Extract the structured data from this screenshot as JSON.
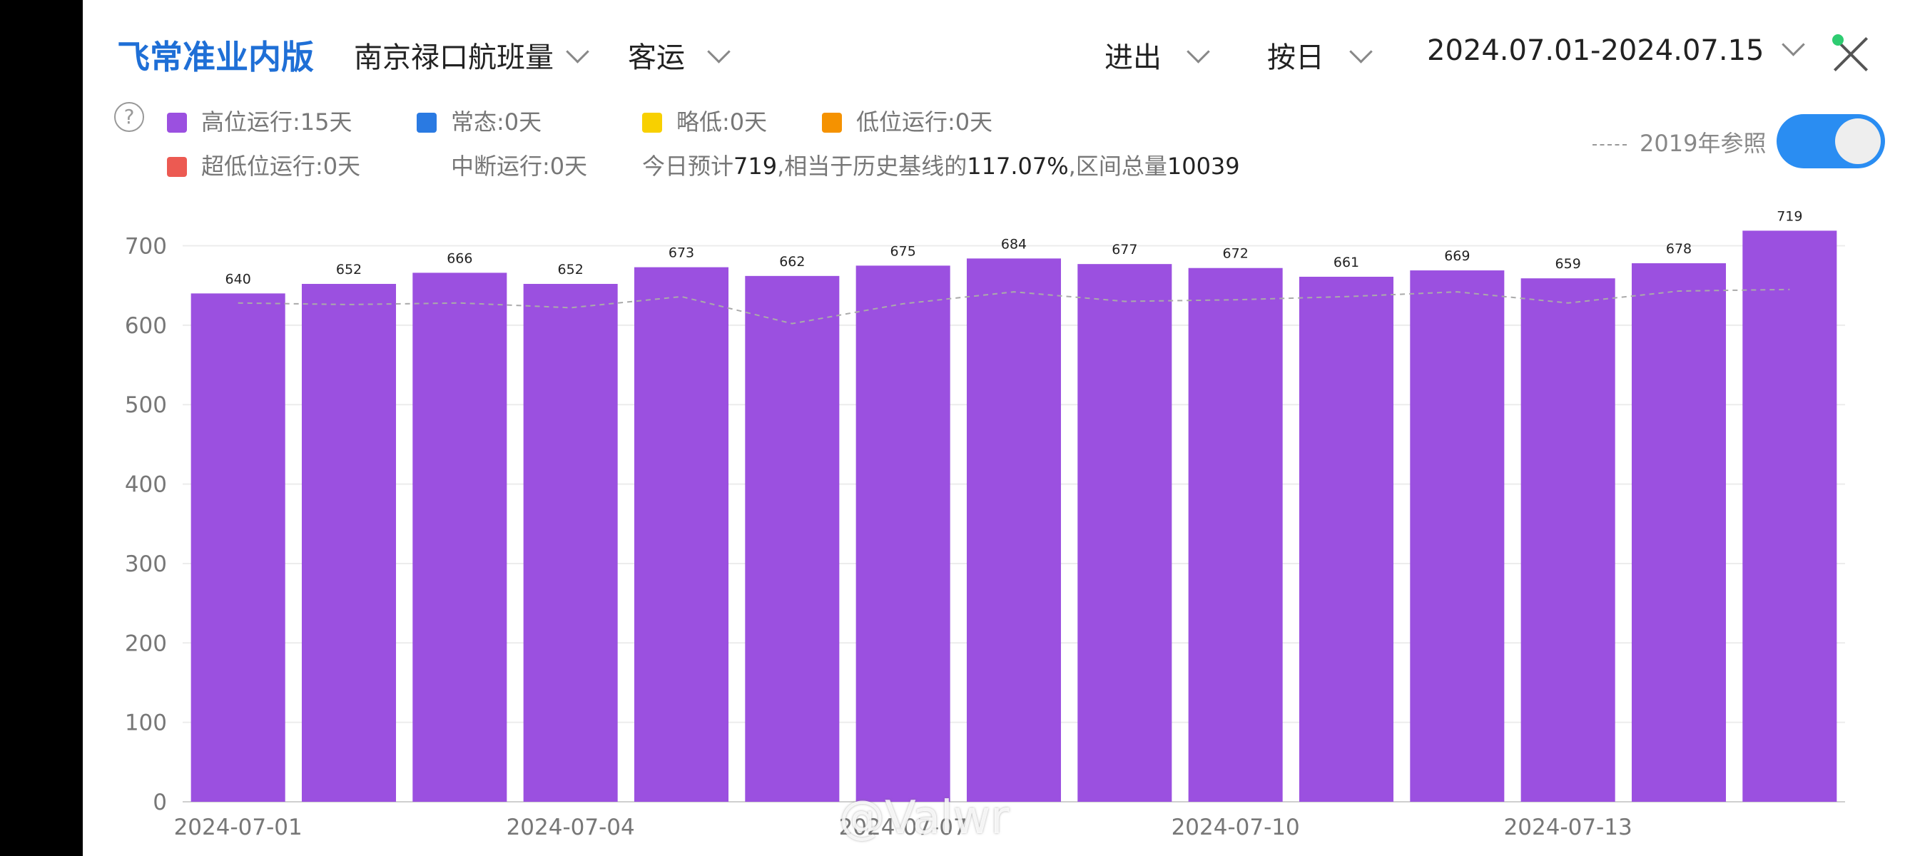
{
  "header": {
    "title": "飞常准业内版",
    "airport_label": "南京禄口航班量",
    "type_label": "客运",
    "direction_label": "进出",
    "granularity_label": "按日",
    "date_range_label": "2024.07.01-2024.07.15"
  },
  "legend": {
    "items": [
      {
        "label": "高位运行:15天",
        "color": "#9b50e0"
      },
      {
        "label": "常态:0天",
        "color": "#2a7ae2"
      },
      {
        "label": "略低:0天",
        "color": "#f8d000"
      },
      {
        "label": "低位运行:0天",
        "color": "#f59200"
      },
      {
        "label": "超低位运行:0天",
        "color": "#ec5a52"
      },
      {
        "label": "中断运行:0天",
        "color": ""
      }
    ],
    "summary": {
      "prefix": "今日预计",
      "today": "719",
      "mid": ",相当于历史基线的",
      "percent": "117.07%",
      "mid2": ",区间总量",
      "total": "10039"
    },
    "reference_label": "2019年参照",
    "reference_toggle_on": true
  },
  "watermark": "@Valwr",
  "chart_data": {
    "type": "bar",
    "categories": [
      "2024-07-01",
      "2024-07-02",
      "2024-07-03",
      "2024-07-04",
      "2024-07-05",
      "2024-07-06",
      "2024-07-07",
      "2024-07-08",
      "2024-07-09",
      "2024-07-10",
      "2024-07-11",
      "2024-07-12",
      "2024-07-13",
      "2024-07-14",
      "2024-07-15"
    ],
    "x_tick_labels_shown": [
      "2024-07-01",
      "2024-07-04",
      "2024-07-07",
      "2024-07-10",
      "2024-07-13"
    ],
    "series": [
      {
        "name": "高位运行",
        "color": "#9b50e0",
        "values": [
          640,
          652,
          666,
          652,
          673,
          662,
          675,
          684,
          677,
          672,
          661,
          669,
          659,
          678,
          719
        ]
      },
      {
        "name": "2019年参照",
        "type": "line",
        "style": "dashed",
        "color": "#aaaaaa",
        "values": [
          628,
          626,
          628,
          622,
          636,
          602,
          627,
          642,
          630,
          632,
          636,
          642,
          628,
          643,
          645
        ]
      }
    ],
    "yticks": [
      0,
      100,
      200,
      300,
      400,
      500,
      600,
      700
    ],
    "ylim": [
      0,
      740
    ],
    "grid": true,
    "data_labels": true
  }
}
